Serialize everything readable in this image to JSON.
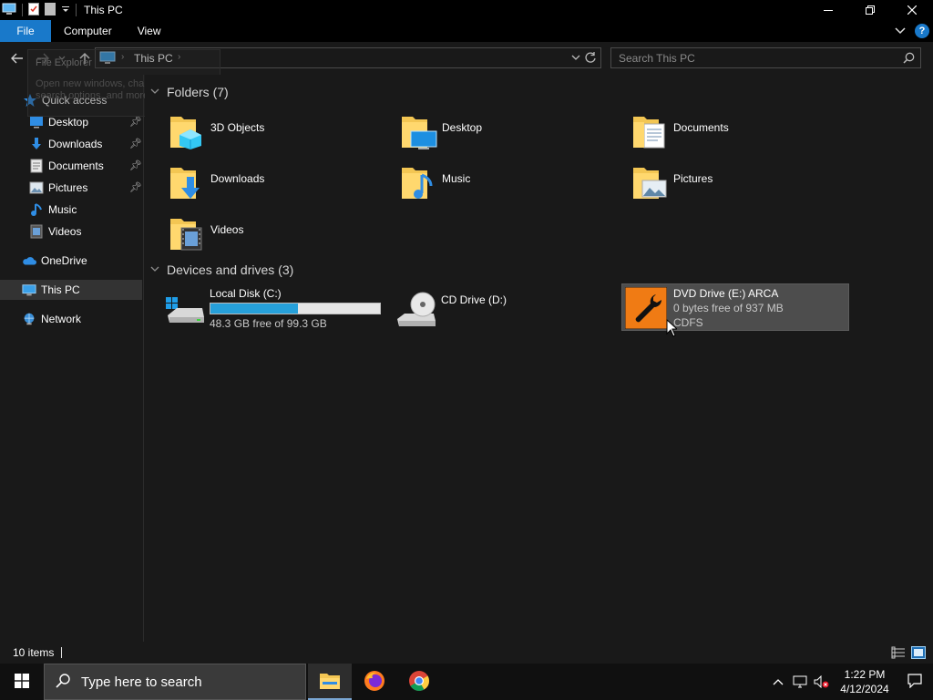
{
  "window": {
    "title": "This PC"
  },
  "ribbon": {
    "tabs": [
      "File",
      "Computer",
      "View"
    ]
  },
  "address": {
    "crumb": "This PC"
  },
  "search": {
    "placeholder": "Search This PC"
  },
  "tooltip": {
    "title": "File Explorer",
    "body": "Open new windows, change folder and search options, and more."
  },
  "sidebar": {
    "items": [
      {
        "label": "Quick access",
        "icon": "star-icon"
      },
      {
        "label": "Desktop",
        "icon": "desktop-icon",
        "pinned": true
      },
      {
        "label": "Downloads",
        "icon": "downloads-icon",
        "pinned": true
      },
      {
        "label": "Documents",
        "icon": "documents-icon",
        "pinned": true
      },
      {
        "label": "Pictures",
        "icon": "pictures-icon",
        "pinned": true
      },
      {
        "label": "Music",
        "icon": "music-icon"
      },
      {
        "label": "Videos",
        "icon": "videos-icon"
      },
      {
        "label": "OneDrive",
        "icon": "cloud-icon"
      },
      {
        "label": "This PC",
        "icon": "computer-icon",
        "selected": true
      },
      {
        "label": "Network",
        "icon": "network-icon"
      }
    ]
  },
  "content": {
    "folders_header": "Folders (7)",
    "folders": [
      {
        "name": "3D Objects",
        "icon": "3d-objects-folder-icon"
      },
      {
        "name": "Desktop",
        "icon": "desktop-folder-icon"
      },
      {
        "name": "Documents",
        "icon": "documents-folder-icon"
      },
      {
        "name": "Downloads",
        "icon": "downloads-folder-icon"
      },
      {
        "name": "Music",
        "icon": "music-folder-icon"
      },
      {
        "name": "Pictures",
        "icon": "pictures-folder-icon"
      },
      {
        "name": "Videos",
        "icon": "videos-folder-icon"
      }
    ],
    "drives_header": "Devices and drives (3)",
    "drives": [
      {
        "name": "Local Disk (C:)",
        "free": "48.3 GB free of 99.3 GB",
        "used_fraction": 0.514
      },
      {
        "name": "CD Drive (D:)"
      },
      {
        "name": "DVD Drive (E:) ARCA",
        "free": "0 bytes free of 937 MB",
        "fs": "CDFS"
      }
    ]
  },
  "status": {
    "count": "10 items"
  },
  "taskbar": {
    "search_label": "Type here to search",
    "time": "1:22 PM",
    "date": "4/12/2024"
  },
  "colors": {
    "accent": "#1979ca",
    "progress": "#26a0da",
    "dvd_orange": "#f07b14"
  }
}
